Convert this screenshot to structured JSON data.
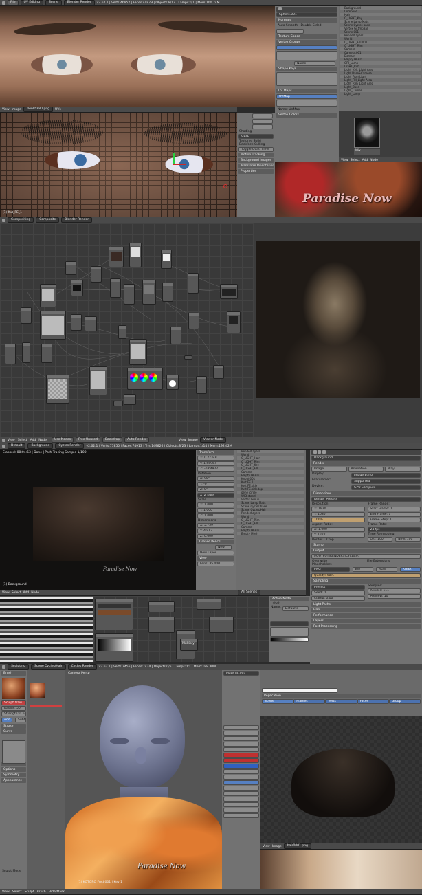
{
  "section1": {
    "editor_type": "UV Editing",
    "scene": "Scene",
    "render_engine": "Blender Render",
    "version_stats": "v2.62.1 | Verts:46952 | Faces:44879 | Objects:8/17 | Lamps:0/1 | Mem:100.74M",
    "uv_object_label": "(1) Kvt_FE_1",
    "image_name": "skin8Y880.png",
    "view_menu": "View",
    "image_menu": "Image",
    "uv_menu": "UVs",
    "shading_panel_label": "Shading",
    "shading_value": "GLSL",
    "textured_solid": "Textured Solid",
    "backface_culling": "Backface Culling",
    "toggle_quad_view": "Toggle Quad View",
    "motion_tracking": "Motion Tracking",
    "background_images": "Background Images",
    "transform_orientations": "Transform Orientations",
    "properties": "Properties",
    "mesh_name": "Sphere.001",
    "normals": "Normals",
    "auto_smooth": "Auto Smooth",
    "double_sided": "Double Sided",
    "texture_space": "Texture Space",
    "vertex_groups": "Vertex Groups",
    "shape_keys": "Shape Keys",
    "uv_maps": "UV Maps",
    "uv_map_item": "UVMap",
    "name_label": "Name",
    "name_value": "UVMap",
    "vertex_colors": "Vertex Colors",
    "mix_label": "Mix",
    "outliner": [
      "Background",
      "Compose",
      "Hair",
      "C_LIGHT_Key",
      "Scene Lamp Mats",
      "Scene Cycles base",
      "Vertex Gr.tmpBall",
      "Scene 001",
      "RenderLayers",
      "World",
      "C_LIGHT_FIll.001",
      "C_LIGHT_Rim",
      "Camera",
      "Camera.001",
      "Domain",
      "Empty HEAD",
      "GRI_Lamp",
      "LIGHT_Rim",
      "Light_Kvit_Light Area",
      "Light Base&Camera",
      "Light_FrontLight",
      "Light_FIll_Light Area",
      "Light_Rim_Light Area",
      "Light_Base",
      "Light_Corner",
      "Light_Lamp"
    ],
    "poster_text": "Paradise Now",
    "hdr2_editor": "Compositing",
    "hdr2_scene": "Composite",
    "hdr2_render": "Blender Render"
  },
  "section2": {
    "menus": [
      "View",
      "Select",
      "Add",
      "Node"
    ],
    "use_nodes": "Use Nodes",
    "free_unused": "Free Unused",
    "backdrop": "Backdrop",
    "auto_render": "Auto Render",
    "view_menu": "View",
    "image_menu": "Image",
    "image_name": "Viewer Node"
  },
  "section3": {
    "editor_type": "Default",
    "scene": "Background",
    "render_engine": "Cycles Render",
    "stats": "v2.62.1 | Verts:77855 | Faces:74913 | Tris:149826 | Objects:8/23 | Lamps:1/14 | Mem:192.42M",
    "viewport_info": "Elapsed: 00:04:53 | Done | Path Tracing Sample 1/100",
    "viewport_bottom_label": "(1) Background",
    "poster_text": "Paradise Now",
    "transform_label": "Transform",
    "location": [
      "X: 0.77348",
      "Y: 1.55967",
      "Z: -0.64977"
    ],
    "rotation_label": "Rotation",
    "rotation": [
      "X: 90°",
      "Y: -0°",
      "Z: 0°"
    ],
    "xyz_euler": "XYZ Euler",
    "scale_label": "Scale",
    "scale": [
      "X: 1.000",
      "Y: 1.000",
      "Z: 1.000"
    ],
    "dimensions_label": "Dimensions",
    "dimensions": [
      "X: 5.759",
      "Y: 4.913",
      "Z: 0.000"
    ],
    "grease_pencil": "Grease Pencil",
    "new_label": "New",
    "new_layer": "New Layer",
    "view_label": "View",
    "lens_label": "Lens: 35.000",
    "outliner": [
      "RenderLayers",
      "World",
      "C_LIGHT_Hair",
      "C_LIGHT_Rim",
      "C_LIGHT_Key",
      "C_LIGHT_Fill",
      "Camera",
      "Empty HEAD",
      "Knopf.001",
      "Kvit.FE.1",
      "Kvit.FE.side",
      "Kvit.FE.side.top",
      "gene_circle",
      "WID stand",
      "Vertex Group",
      "Scene Lamp Mats",
      "Scene Cycles base",
      "Scene Cycles/Hair",
      "RenderLayers",
      "World",
      "C_LIGHT_Rim",
      "C_LIGHT_Fill",
      "Camera",
      "Empty HEAD",
      "Empty Mesh"
    ],
    "render_panel_label": "Render",
    "render_buttons": [
      "Image",
      "Animation",
      "Play"
    ],
    "display_label": "Display:",
    "display_value": "Image Editor",
    "feature_set_label": "Feature Set:",
    "feature_set_value": "Supported",
    "device_label": "Device:",
    "device_value": "GPU Compute",
    "dimensions_panel": "Dimensions",
    "render_presets": "Render Presets",
    "resolution_label": "Resolution:",
    "res_x": "X: 1920",
    "res_y": "Y: 1080",
    "res_pct": "100%",
    "frame_range_label": "Frame Range:",
    "start_frame": "Start Frame: 1",
    "end_frame": "End Frame: 1",
    "frame_step": "Frame Step: 1",
    "aspect_label": "Aspect Ratio:",
    "aspect_x": "X: 1.000",
    "aspect_y": "Y: 1.000",
    "frame_rate_label": "Frame Rate:",
    "frame_rate": "24 fps",
    "time_remap": "Time Remapping:",
    "old": "Old: 100",
    "new": "New: 100",
    "border": "Border",
    "crop": "Crop",
    "stamp": "Stamp",
    "output": "Output",
    "output_path": "//OUTPUT\\RENDERS\\CYCLES\\",
    "overwrite": "Overwrite",
    "file_extensions": "File Extensions",
    "placeholders": "Placeholders",
    "file_format": "PNG",
    "bw": "BW",
    "rgb": "RGB",
    "rgba": "RGBA",
    "quality": "Quality: 90%",
    "sampling": "Sampling",
    "presets": "Presets",
    "seed": "Seed: 0",
    "clamp": "Clamp: 0.00",
    "render_samples": "Render: 111",
    "preview_samples": "Preview: 10",
    "light_paths": "Light Paths",
    "film": "Film",
    "performance": "Performance",
    "layers": "Layers",
    "post_processing": "Post Processing",
    "scene_view": "All Scenes",
    "active_node": "Active Node",
    "label_label": "Label:",
    "name_label": "Name:",
    "name_value": "Defaults"
  },
  "section4": {
    "editor_type": "Sculpting",
    "scene": "Scene Cycles/Hair",
    "render_engine": "Cycles Render",
    "stats": "v2.62.1 | Verts:7455 | Faces:7424 | Objects:0/5 | Lamps:0/1 | Mem:188.30M",
    "viewport_title": "Camera Persp",
    "brush_label": "Brush",
    "brush_name": "SculptDraw",
    "radius": "Radius: 50",
    "strength": "Strength: 0.500",
    "add": "Add",
    "subtract": "Subtract",
    "stroke": "Stroke",
    "curve": "Curve",
    "texture": "Texture",
    "options": "Options",
    "symmetry": "Symmetry",
    "appearance": "Appearance",
    "viewport_bottom_label": "(1) KOTORO Fred.001 | Key 1",
    "poster_text": "Paradise Now",
    "tabs": [
      "Scene",
      "Frames",
      "Verts",
      "Faces",
      "Group"
    ],
    "replication": "Replication",
    "sculpt_mode": "Sculpt Mode",
    "image_name": "hair0001.png",
    "menus": [
      "View",
      "Image"
    ],
    "bottom_menus": [
      "View",
      "Select",
      "Sculpt",
      "Brush",
      "Hide/Mask"
    ],
    "material": "Material.003"
  }
}
